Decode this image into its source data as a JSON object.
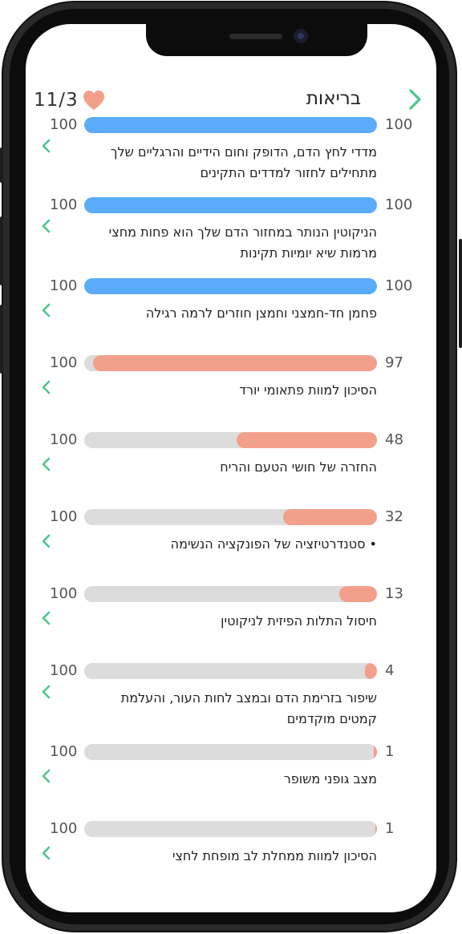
{
  "header": {
    "title": "בריאות",
    "count": "11/3"
  },
  "colors": {
    "blue": "#5aacfa",
    "salmon": "#f2a08b",
    "track": "#dcdcdc",
    "chevron": "#47c98a"
  },
  "benefits": [
    {
      "max": "100",
      "value": "100",
      "progress": 1.0,
      "color": "blue",
      "text": [
        "מדדי לחץ הדם, הדופק וחום הידיים והרגליים שלך",
        "מתחילים לחזור למדדים התקינים"
      ]
    },
    {
      "max": "100",
      "value": "100",
      "progress": 1.0,
      "color": "blue",
      "text": [
        "הניקוטין הנותר במחזור הדם שלך הוא פחות מחצי",
        "מרמות שיא יומיות תקינות"
      ]
    },
    {
      "max": "100",
      "value": "100",
      "progress": 1.0,
      "color": "blue",
      "text": [
        "פחמן חד-חמצני וחמצן חוזרים לרמה רגילה"
      ]
    },
    {
      "max": "100",
      "value": "97",
      "progress": 0.97,
      "color": "salmon",
      "text": [
        "הסיכון למוות פתאומי יורד"
      ]
    },
    {
      "max": "100",
      "value": "48",
      "progress": 0.48,
      "color": "salmon",
      "text": [
        "החזרה של חושי הטעם והריח"
      ]
    },
    {
      "max": "100",
      "value": "32",
      "progress": 0.32,
      "color": "salmon",
      "text": [
        "• סטנדרטיזציה של הפונקציה הנשימה"
      ]
    },
    {
      "max": "100",
      "value": "13",
      "progress": 0.13,
      "color": "salmon",
      "text": [
        "חיסול התלות הפיזית לניקוטין"
      ]
    },
    {
      "max": "100",
      "value": "4",
      "progress": 0.04,
      "color": "salmon",
      "text": [
        "שיפור בזרימת הדם ובמצב לחות העור, והעלמת",
        "קמטים מוקדמים"
      ]
    },
    {
      "max": "100",
      "value": "1",
      "progress": 0.01,
      "color": "salmon",
      "text": [
        "מצב גופני משופר"
      ]
    },
    {
      "max": "100",
      "value": "1",
      "progress": 0.005,
      "color": "salmon",
      "text": [
        "הסיכון למוות ממחלת לב מופחת לחצי"
      ]
    }
  ]
}
